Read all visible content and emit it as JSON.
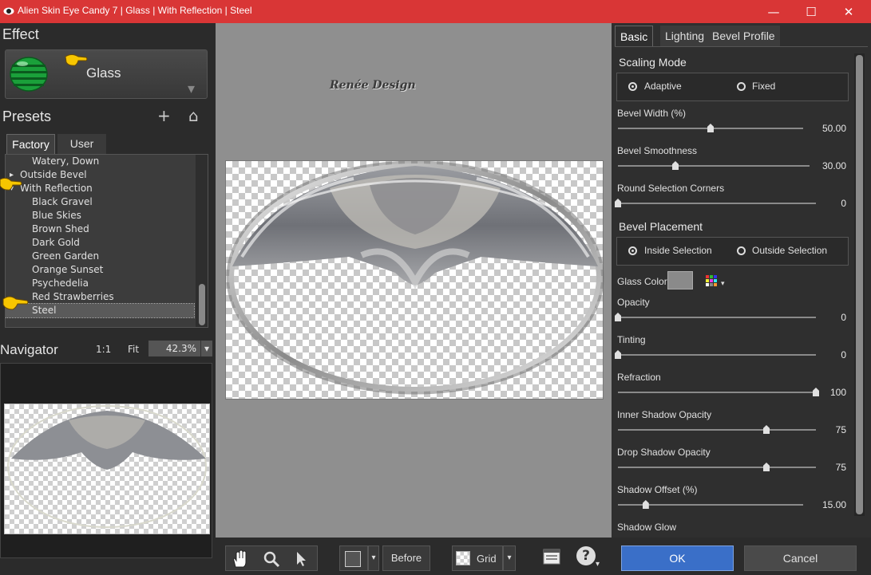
{
  "window": {
    "title": "Alien Skin Eye Candy 7 | Glass | With Reflection | Steel",
    "minimize": "—",
    "maximize": "☐",
    "close": "✕"
  },
  "effect": {
    "header": "Effect",
    "name": "Glass",
    "dropdown": "▾"
  },
  "presets": {
    "header": "Presets",
    "add": "+",
    "home": "⌂",
    "tabs": [
      "Factory",
      "User"
    ],
    "items": [
      {
        "label": "Watery, Down",
        "indent": 2
      },
      {
        "label": "Outside Bevel",
        "indent": 1,
        "arrow": "▸"
      },
      {
        "label": "With Reflection",
        "indent": 1,
        "arrow": "▾"
      },
      {
        "label": "Black Gravel",
        "indent": 2
      },
      {
        "label": "Blue Skies",
        "indent": 2
      },
      {
        "label": "Brown Shed",
        "indent": 2
      },
      {
        "label": "Dark Gold",
        "indent": 2
      },
      {
        "label": "Green Garden",
        "indent": 2
      },
      {
        "label": "Orange Sunset",
        "indent": 2
      },
      {
        "label": "Psychedelia",
        "indent": 2
      },
      {
        "label": "Red Strawberries",
        "indent": 2
      },
      {
        "label": "Steel",
        "indent": 2,
        "selected": true
      }
    ]
  },
  "navigator": {
    "header": "Navigator",
    "one_to_one": "1:1",
    "fit": "Fit",
    "zoom": "42.3%",
    "zoom_arrow": "▾"
  },
  "canvas": {
    "watermark": "Renée Design"
  },
  "toolbar": {
    "before": "Before",
    "grid": "Grid",
    "dropdown": "▾",
    "help": "?"
  },
  "tabs": [
    "Basic",
    "Lighting",
    "Bevel Profile"
  ],
  "basic": {
    "scaling_mode": {
      "title": "Scaling Mode",
      "options": [
        "Adaptive",
        "Fixed"
      ],
      "selected": 0
    },
    "bevel_width": {
      "label": "Bevel Width (%)",
      "value": "50.00",
      "pos": 0.5
    },
    "bevel_smoothness": {
      "label": "Bevel Smoothness",
      "value": "30.00",
      "pos": 0.3
    },
    "round_corners": {
      "label": "Round Selection Corners",
      "value": "0",
      "pos": 0
    },
    "bevel_placement": {
      "title": "Bevel Placement",
      "options": [
        "Inside Selection",
        "Outside Selection"
      ],
      "selected": 0
    },
    "glass_color": {
      "label": "Glass Color",
      "color": "#8a8a8a"
    },
    "opacity": {
      "label": "Opacity",
      "value": "0",
      "pos": 0
    },
    "tinting": {
      "label": "Tinting",
      "value": "0",
      "pos": 0
    },
    "refraction": {
      "label": "Refraction",
      "value": "100",
      "pos": 1
    },
    "inner_shadow_opacity": {
      "label": "Inner Shadow Opacity",
      "value": "75",
      "pos": 0.75
    },
    "drop_shadow_opacity": {
      "label": "Drop Shadow Opacity",
      "value": "75",
      "pos": 0.75
    },
    "shadow_offset": {
      "label": "Shadow Offset (%)",
      "value": "15.00",
      "pos": 0.15
    },
    "shadow_glow": {
      "label": "Shadow Glow"
    }
  },
  "buttons": {
    "ok": "OK",
    "cancel": "Cancel"
  },
  "colors": {
    "titlebar": "#d93636",
    "ok_button": "#3a6fc8",
    "panel": "#2b2b2b",
    "canvas_bg": "#8f8f8f"
  }
}
